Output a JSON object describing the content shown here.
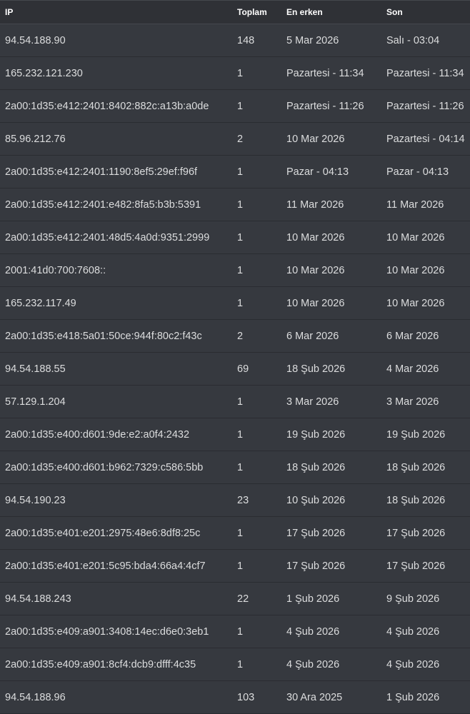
{
  "table": {
    "headers": {
      "ip": "IP",
      "total": "Toplam",
      "first": "En erken",
      "last": "Son"
    },
    "rows": [
      {
        "ip": "94.54.188.90",
        "total": "148",
        "first": "5 Mar 2026",
        "last": "Salı - 03:04"
      },
      {
        "ip": "165.232.121.230",
        "total": "1",
        "first": "Pazartesi - 11:34",
        "last": "Pazartesi - 11:34"
      },
      {
        "ip": "2a00:1d35:e412:2401:8402:882c:a13b:a0de",
        "total": "1",
        "first": "Pazartesi - 11:26",
        "last": "Pazartesi - 11:26"
      },
      {
        "ip": "85.96.212.76",
        "total": "2",
        "first": "10 Mar 2026",
        "last": "Pazartesi - 04:14"
      },
      {
        "ip": "2a00:1d35:e412:2401:1190:8ef5:29ef:f96f",
        "total": "1",
        "first": "Pazar - 04:13",
        "last": "Pazar - 04:13"
      },
      {
        "ip": "2a00:1d35:e412:2401:e482:8fa5:b3b:5391",
        "total": "1",
        "first": "11 Mar 2026",
        "last": "11 Mar 2026"
      },
      {
        "ip": "2a00:1d35:e412:2401:48d5:4a0d:9351:2999",
        "total": "1",
        "first": "10 Mar 2026",
        "last": "10 Mar 2026"
      },
      {
        "ip": "2001:41d0:700:7608::",
        "total": "1",
        "first": "10 Mar 2026",
        "last": "10 Mar 2026"
      },
      {
        "ip": "165.232.117.49",
        "total": "1",
        "first": "10 Mar 2026",
        "last": "10 Mar 2026"
      },
      {
        "ip": "2a00:1d35:e418:5a01:50ce:944f:80c2:f43c",
        "total": "2",
        "first": "6 Mar 2026",
        "last": "6 Mar 2026"
      },
      {
        "ip": "94.54.188.55",
        "total": "69",
        "first": "18 Şub 2026",
        "last": "4 Mar 2026"
      },
      {
        "ip": "57.129.1.204",
        "total": "1",
        "first": "3 Mar 2026",
        "last": "3 Mar 2026"
      },
      {
        "ip": "2a00:1d35:e400:d601:9de:e2:a0f4:2432",
        "total": "1",
        "first": "19 Şub 2026",
        "last": "19 Şub 2026"
      },
      {
        "ip": "2a00:1d35:e400:d601:b962:7329:c586:5bb",
        "total": "1",
        "first": "18 Şub 2026",
        "last": "18 Şub 2026"
      },
      {
        "ip": "94.54.190.23",
        "total": "23",
        "first": "10 Şub 2026",
        "last": "18 Şub 2026"
      },
      {
        "ip": "2a00:1d35:e401:e201:2975:48e6:8df8:25c",
        "total": "1",
        "first": "17 Şub 2026",
        "last": "17 Şub 2026"
      },
      {
        "ip": "2a00:1d35:e401:e201:5c95:bda4:66a4:4cf7",
        "total": "1",
        "first": "17 Şub 2026",
        "last": "17 Şub 2026"
      },
      {
        "ip": "94.54.188.243",
        "total": "22",
        "first": "1 Şub 2026",
        "last": "9 Şub 2026"
      },
      {
        "ip": "2a00:1d35:e409:a901:3408:14ec:d6e0:3eb1",
        "total": "1",
        "first": "4 Şub 2026",
        "last": "4 Şub 2026"
      },
      {
        "ip": "2a00:1d35:e409:a901:8cf4:dcb9:dfff:4c35",
        "total": "1",
        "first": "4 Şub 2026",
        "last": "4 Şub 2026"
      },
      {
        "ip": "94.54.188.96",
        "total": "103",
        "first": "30 Ara 2025",
        "last": "1 Şub 2026"
      }
    ]
  },
  "colors": {
    "background": "#2f3136",
    "row_background": "#36393f",
    "text": "#dcddde",
    "header_text": "#ffffff"
  }
}
